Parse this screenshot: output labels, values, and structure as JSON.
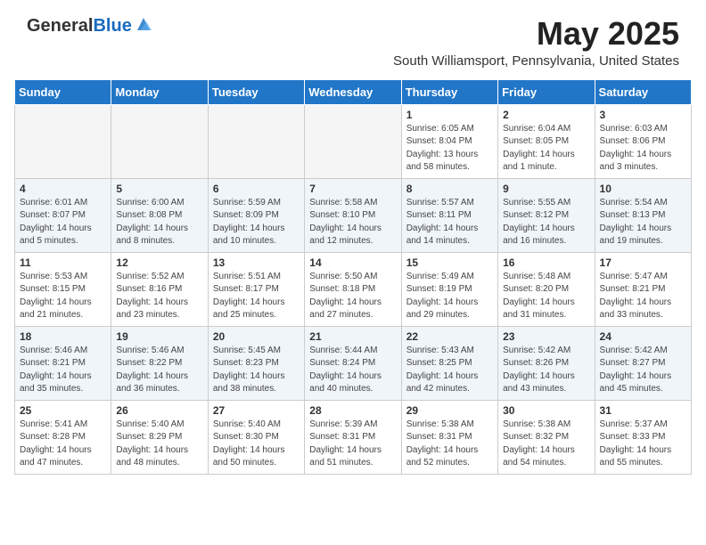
{
  "header": {
    "logo_general": "General",
    "logo_blue": "Blue",
    "month_year": "May 2025",
    "subtitle": "South Williamsport, Pennsylvania, United States"
  },
  "days_of_week": [
    "Sunday",
    "Monday",
    "Tuesday",
    "Wednesday",
    "Thursday",
    "Friday",
    "Saturday"
  ],
  "weeks": [
    [
      {
        "day": "",
        "info": ""
      },
      {
        "day": "",
        "info": ""
      },
      {
        "day": "",
        "info": ""
      },
      {
        "day": "",
        "info": ""
      },
      {
        "day": "1",
        "info": "Sunrise: 6:05 AM\nSunset: 8:04 PM\nDaylight: 13 hours\nand 58 minutes."
      },
      {
        "day": "2",
        "info": "Sunrise: 6:04 AM\nSunset: 8:05 PM\nDaylight: 14 hours\nand 1 minute."
      },
      {
        "day": "3",
        "info": "Sunrise: 6:03 AM\nSunset: 8:06 PM\nDaylight: 14 hours\nand 3 minutes."
      }
    ],
    [
      {
        "day": "4",
        "info": "Sunrise: 6:01 AM\nSunset: 8:07 PM\nDaylight: 14 hours\nand 5 minutes."
      },
      {
        "day": "5",
        "info": "Sunrise: 6:00 AM\nSunset: 8:08 PM\nDaylight: 14 hours\nand 8 minutes."
      },
      {
        "day": "6",
        "info": "Sunrise: 5:59 AM\nSunset: 8:09 PM\nDaylight: 14 hours\nand 10 minutes."
      },
      {
        "day": "7",
        "info": "Sunrise: 5:58 AM\nSunset: 8:10 PM\nDaylight: 14 hours\nand 12 minutes."
      },
      {
        "day": "8",
        "info": "Sunrise: 5:57 AM\nSunset: 8:11 PM\nDaylight: 14 hours\nand 14 minutes."
      },
      {
        "day": "9",
        "info": "Sunrise: 5:55 AM\nSunset: 8:12 PM\nDaylight: 14 hours\nand 16 minutes."
      },
      {
        "day": "10",
        "info": "Sunrise: 5:54 AM\nSunset: 8:13 PM\nDaylight: 14 hours\nand 19 minutes."
      }
    ],
    [
      {
        "day": "11",
        "info": "Sunrise: 5:53 AM\nSunset: 8:15 PM\nDaylight: 14 hours\nand 21 minutes."
      },
      {
        "day": "12",
        "info": "Sunrise: 5:52 AM\nSunset: 8:16 PM\nDaylight: 14 hours\nand 23 minutes."
      },
      {
        "day": "13",
        "info": "Sunrise: 5:51 AM\nSunset: 8:17 PM\nDaylight: 14 hours\nand 25 minutes."
      },
      {
        "day": "14",
        "info": "Sunrise: 5:50 AM\nSunset: 8:18 PM\nDaylight: 14 hours\nand 27 minutes."
      },
      {
        "day": "15",
        "info": "Sunrise: 5:49 AM\nSunset: 8:19 PM\nDaylight: 14 hours\nand 29 minutes."
      },
      {
        "day": "16",
        "info": "Sunrise: 5:48 AM\nSunset: 8:20 PM\nDaylight: 14 hours\nand 31 minutes."
      },
      {
        "day": "17",
        "info": "Sunrise: 5:47 AM\nSunset: 8:21 PM\nDaylight: 14 hours\nand 33 minutes."
      }
    ],
    [
      {
        "day": "18",
        "info": "Sunrise: 5:46 AM\nSunset: 8:21 PM\nDaylight: 14 hours\nand 35 minutes."
      },
      {
        "day": "19",
        "info": "Sunrise: 5:46 AM\nSunset: 8:22 PM\nDaylight: 14 hours\nand 36 minutes."
      },
      {
        "day": "20",
        "info": "Sunrise: 5:45 AM\nSunset: 8:23 PM\nDaylight: 14 hours\nand 38 minutes."
      },
      {
        "day": "21",
        "info": "Sunrise: 5:44 AM\nSunset: 8:24 PM\nDaylight: 14 hours\nand 40 minutes."
      },
      {
        "day": "22",
        "info": "Sunrise: 5:43 AM\nSunset: 8:25 PM\nDaylight: 14 hours\nand 42 minutes."
      },
      {
        "day": "23",
        "info": "Sunrise: 5:42 AM\nSunset: 8:26 PM\nDaylight: 14 hours\nand 43 minutes."
      },
      {
        "day": "24",
        "info": "Sunrise: 5:42 AM\nSunset: 8:27 PM\nDaylight: 14 hours\nand 45 minutes."
      }
    ],
    [
      {
        "day": "25",
        "info": "Sunrise: 5:41 AM\nSunset: 8:28 PM\nDaylight: 14 hours\nand 47 minutes."
      },
      {
        "day": "26",
        "info": "Sunrise: 5:40 AM\nSunset: 8:29 PM\nDaylight: 14 hours\nand 48 minutes."
      },
      {
        "day": "27",
        "info": "Sunrise: 5:40 AM\nSunset: 8:30 PM\nDaylight: 14 hours\nand 50 minutes."
      },
      {
        "day": "28",
        "info": "Sunrise: 5:39 AM\nSunset: 8:31 PM\nDaylight: 14 hours\nand 51 minutes."
      },
      {
        "day": "29",
        "info": "Sunrise: 5:38 AM\nSunset: 8:31 PM\nDaylight: 14 hours\nand 52 minutes."
      },
      {
        "day": "30",
        "info": "Sunrise: 5:38 AM\nSunset: 8:32 PM\nDaylight: 14 hours\nand 54 minutes."
      },
      {
        "day": "31",
        "info": "Sunrise: 5:37 AM\nSunset: 8:33 PM\nDaylight: 14 hours\nand 55 minutes."
      }
    ]
  ]
}
